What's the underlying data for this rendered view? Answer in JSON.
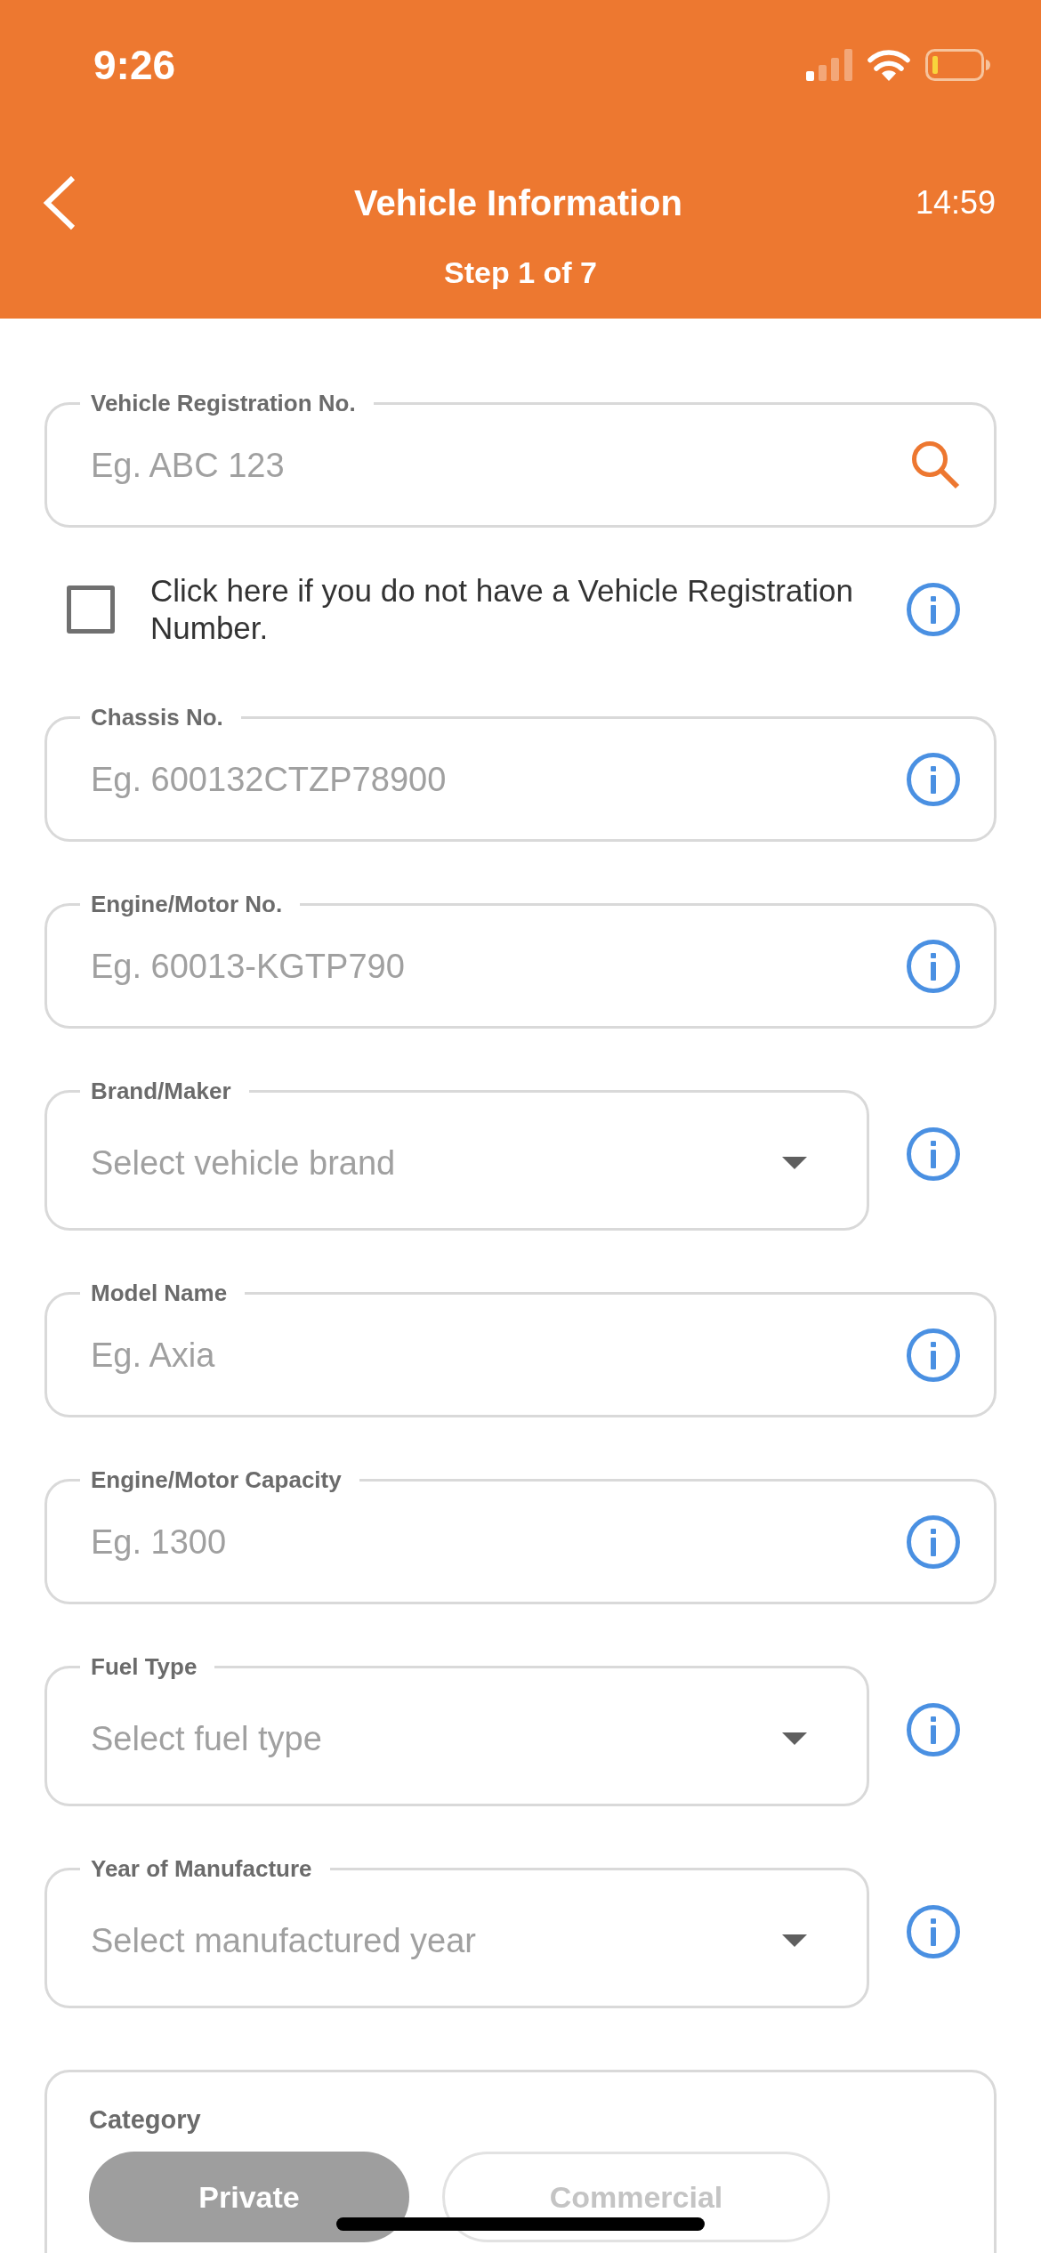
{
  "status_bar": {
    "time": "9:26"
  },
  "header": {
    "title": "Vehicle Information",
    "step": "Step 1 of 7",
    "timer": "14:59"
  },
  "form": [
    {
      "kind": "search",
      "label": "Vehicle Registration No.",
      "placeholder": "Eg. ABC 123"
    },
    {
      "kind": "checkbox",
      "label": "Click here if you do not have a Vehicle Registration Number.",
      "checked": false
    },
    {
      "kind": "text",
      "label": "Chassis No.",
      "placeholder": "Eg. 600132CTZP78900"
    },
    {
      "kind": "text",
      "label": "Engine/Motor No.",
      "placeholder": "Eg. 60013-KGTP790"
    },
    {
      "kind": "select",
      "label": "Brand/Maker",
      "placeholder": "Select vehicle brand"
    },
    {
      "kind": "text",
      "label": "Model Name",
      "placeholder": "Eg. Axia"
    },
    {
      "kind": "text",
      "label": "Engine/Motor Capacity",
      "placeholder": "Eg. 1300"
    },
    {
      "kind": "select",
      "label": "Fuel Type",
      "placeholder": "Select fuel type"
    },
    {
      "kind": "select",
      "label": "Year of Manufacture",
      "placeholder": "Select manufactured year"
    }
  ],
  "category": {
    "label": "Category",
    "options": [
      {
        "label": "Private",
        "selected": true
      },
      {
        "label": "Commercial",
        "selected": false
      }
    ]
  }
}
